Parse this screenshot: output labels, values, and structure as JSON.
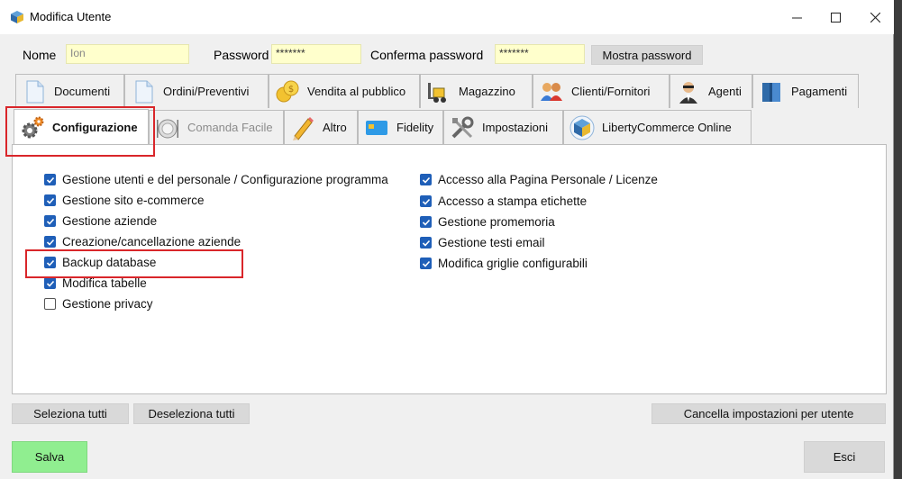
{
  "window": {
    "title": "Modifica Utente"
  },
  "form": {
    "nome_label": "Nome",
    "nome_value": "Ion",
    "password_label": "Password",
    "password_value": "*******",
    "conferma_label": "Conferma password",
    "conferma_value": "*******",
    "mostra_button": "Mostra password"
  },
  "tabs": [
    {
      "label": "Documenti",
      "icon": "document-icon"
    },
    {
      "label": "Ordini/Preventivi",
      "icon": "document-icon"
    },
    {
      "label": "Vendita al pubblico",
      "icon": "coins-icon"
    },
    {
      "label": "Magazzino",
      "icon": "forklift-icon"
    },
    {
      "label": "Clienti/Fornitori",
      "icon": "people-icon"
    },
    {
      "label": "Agenti",
      "icon": "agent-icon"
    },
    {
      "label": "Pagamenti",
      "icon": "binder-icon"
    },
    {
      "label": "Configurazione",
      "icon": "gear-icon",
      "active": true
    },
    {
      "label": "Comanda Facile",
      "icon": "plate-icon",
      "disabled": true
    },
    {
      "label": "Altro",
      "icon": "pencil-icon"
    },
    {
      "label": "Fidelity",
      "icon": "card-icon"
    },
    {
      "label": "Impostazioni",
      "icon": "tools-icon"
    },
    {
      "label": "LibertyCommerce Online",
      "icon": "cube-icon"
    }
  ],
  "permissions_left": [
    {
      "label": "Gestione utenti e del personale / Configurazione programma",
      "checked": true
    },
    {
      "label": "Gestione sito e-commerce",
      "checked": true
    },
    {
      "label": "Gestione aziende",
      "checked": true
    },
    {
      "label": "Creazione/cancellazione aziende",
      "checked": true
    },
    {
      "label": "Backup database",
      "checked": true
    },
    {
      "label": "Modifica tabelle",
      "checked": true
    },
    {
      "label": "Gestione privacy",
      "checked": false
    }
  ],
  "permissions_right": [
    {
      "label": "Accesso alla Pagina Personale / Licenze",
      "checked": true
    },
    {
      "label": "Accesso a stampa etichette",
      "checked": true
    },
    {
      "label": "Gestione promemoria",
      "checked": true
    },
    {
      "label": "Gestione testi email",
      "checked": true
    },
    {
      "label": "Modifica griglie configurabili",
      "checked": true
    }
  ],
  "buttons": {
    "seleziona": "Seleziona tutti",
    "deseleziona": "Deseleziona tutti",
    "cancella": "Cancella impostazioni per utente",
    "salva": "Salva",
    "esci": "Esci"
  },
  "colors": {
    "accent": "#1f5fb8",
    "input_bg": "#ffffcc",
    "salva_bg": "#90ee90",
    "highlight": "#d9262a"
  }
}
